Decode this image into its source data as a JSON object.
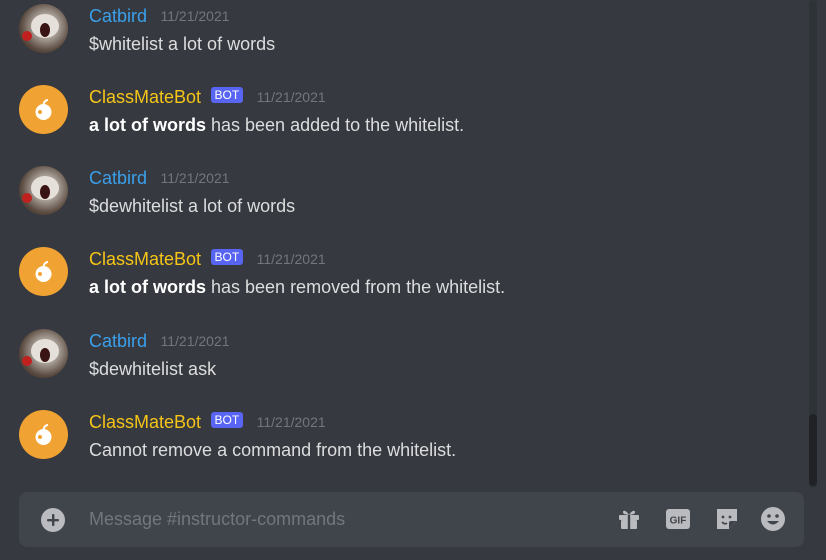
{
  "channel": {
    "placeholder": "Message #instructor-commands"
  },
  "bot_tag": "BOT",
  "messages": [
    {
      "author": "Catbird",
      "is_bot": false,
      "timestamp": "11/21/2021",
      "bold": "",
      "text": "$whitelist a lot of words"
    },
    {
      "author": "ClassMateBot",
      "is_bot": true,
      "timestamp": "11/21/2021",
      "bold": "a lot of words",
      "text": " has been added to the whitelist."
    },
    {
      "author": "Catbird",
      "is_bot": false,
      "timestamp": "11/21/2021",
      "bold": "",
      "text": "$dewhitelist a lot of words"
    },
    {
      "author": "ClassMateBot",
      "is_bot": true,
      "timestamp": "11/21/2021",
      "bold": "a lot of words",
      "text": " has been removed from the whitelist."
    },
    {
      "author": "Catbird",
      "is_bot": false,
      "timestamp": "11/21/2021",
      "bold": "",
      "text": "$dewhitelist ask"
    },
    {
      "author": "ClassMateBot",
      "is_bot": true,
      "timestamp": "11/21/2021",
      "bold": "",
      "text": "Cannot remove a command from the whitelist."
    }
  ],
  "composer_icons": [
    "add-icon",
    "gift-icon",
    "gif-icon",
    "sticker-icon",
    "emoji-icon"
  ],
  "colors": {
    "background": "#36393f",
    "user_name": "#3ba0ec",
    "bot_name": "#f5c518",
    "bot_tag": "#5865f2",
    "bot_avatar": "#f0a232"
  }
}
